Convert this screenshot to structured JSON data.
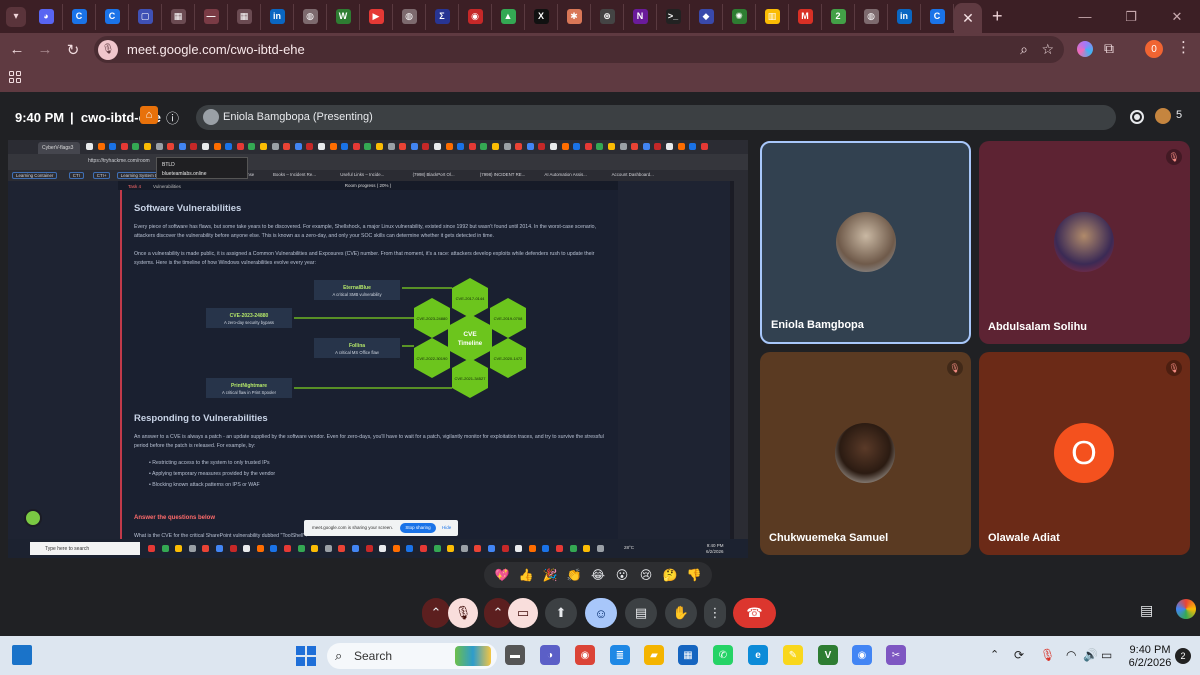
{
  "browser": {
    "tab_menu_icon": "chevron-down-icon",
    "tabs": [
      {
        "icon": "discord-icon",
        "color": "#5865f2",
        "glyph": "◕"
      },
      {
        "icon": "c-app-icon",
        "color": "#1a73e8",
        "glyph": "C"
      },
      {
        "icon": "c-app-icon",
        "color": "#1a73e8",
        "glyph": "C"
      },
      {
        "icon": "app-icon",
        "color": "#3f51b5",
        "glyph": "▢"
      },
      {
        "icon": "grid-icon",
        "color": "#6b4b52",
        "glyph": "▦"
      },
      {
        "icon": "dash-icon",
        "color": "#7a3b45",
        "glyph": "—"
      },
      {
        "icon": "grid-icon",
        "color": "#6b4b52",
        "glyph": "▦"
      },
      {
        "icon": "linkedin-icon",
        "color": "#0a66c2",
        "glyph": "in"
      },
      {
        "icon": "globe-icon",
        "color": "#7d6a6e",
        "glyph": "◍"
      },
      {
        "icon": "w-app-icon",
        "color": "#2e7d32",
        "glyph": "W"
      },
      {
        "icon": "youtube-icon",
        "color": "#e53935",
        "glyph": "▶"
      },
      {
        "icon": "globe-icon",
        "color": "#7d6a6e",
        "glyph": "◍"
      },
      {
        "icon": "app-icon",
        "color": "#283593",
        "glyph": "Σ"
      },
      {
        "icon": "app-icon",
        "color": "#c62828",
        "glyph": "◉"
      },
      {
        "icon": "drive-icon",
        "color": "#34a853",
        "glyph": "▲"
      },
      {
        "icon": "x-icon",
        "color": "#111111",
        "glyph": "X"
      },
      {
        "icon": "claude-icon",
        "color": "#d97757",
        "glyph": "✱"
      },
      {
        "icon": "chatgpt-icon",
        "color": "#444444",
        "glyph": "⊛"
      },
      {
        "icon": "n-app-icon",
        "color": "#6a1b9a",
        "glyph": "N"
      },
      {
        "icon": "terminal-icon",
        "color": "#222222",
        "glyph": ">_"
      },
      {
        "icon": "app-icon",
        "color": "#3949ab",
        "glyph": "◆"
      },
      {
        "icon": "app-icon",
        "color": "#2e7d32",
        "glyph": "✺"
      },
      {
        "icon": "app-icon",
        "color": "#fbbc04",
        "glyph": "▥"
      },
      {
        "icon": "gmail-icon",
        "color": "#d93025",
        "glyph": "M"
      },
      {
        "icon": "app-icon",
        "color": "#43a047",
        "glyph": "2"
      },
      {
        "icon": "globe-icon",
        "color": "#7d6a6e",
        "glyph": "◍"
      },
      {
        "icon": "linkedin-icon",
        "color": "#0a66c2",
        "glyph": "in"
      },
      {
        "icon": "c-app-icon",
        "color": "#1a73e8",
        "glyph": "C"
      }
    ],
    "active_tab_close": "✕",
    "new_tab": "+",
    "window_controls": [
      "—",
      "❐",
      "✕"
    ],
    "back": "←",
    "forward": "→",
    "reload": "↻",
    "url": "meet.google.com/cwo-ibtd-ehe",
    "profile_initial": "0",
    "kebab": "⋮"
  },
  "meet": {
    "time": "9:40 PM",
    "separator": "|",
    "code": "cwo-ibtd-ehe",
    "presenting_label": "Eniola Bamgbopa (Presenting)",
    "participant_count": "5",
    "participants": [
      {
        "name": "Eniola Bamgbopa",
        "muted": false
      },
      {
        "name": "Abdulsalam Solihu",
        "muted": true
      },
      {
        "name": "Chukwuemeka Samuel",
        "muted": true
      },
      {
        "name": "Olawale Adiat",
        "muted": true,
        "initial": "O"
      }
    ],
    "reactions": [
      "💖",
      "👍",
      "🎉",
      "👏",
      "😂",
      "😮",
      "😢",
      "🤔",
      "👎"
    ],
    "controls": {
      "mic_off": "mic-off-icon",
      "cam_off": "camera-off-icon",
      "present": "present-screen-icon",
      "emoji": "emoji-icon",
      "captions": "captions-icon",
      "raise_hand": "raise-hand-icon",
      "more": "more-options-icon",
      "end_call": "end-call-icon"
    }
  },
  "shared_screen": {
    "tab_title": "CyberV-flags3",
    "url": "https://tryhackme.com/room",
    "tooltip_title": "BTLD",
    "tooltip_sub": "blueteamlabs.online",
    "bookmarks": [
      "Learning Container",
      "CTI",
      "CTI+",
      "Learning System Design",
      "CCNA",
      "SA Incident Response",
      "Books – Incident Re...",
      "Useful Links – Incide...",
      "(7998) BlackPort Ol...",
      "(7998) INCIDENT RE...",
      "AI Automation Assis...",
      "Account Dashboard..."
    ],
    "task_label": "Task 4",
    "task_title": "Vulnerabilities",
    "room_progress": "Room progress ( 20% )",
    "heading1": "Software Vulnerabilities",
    "para1": "Every piece of software has flaws, but some take years to be discovered. For example, Shellshock, a major Linux vulnerability, existed since 1992 but wasn't found until 2014. In the worst-case scenario, attackers discover the vulnerability before anyone else. This is known as a zero-day, and only your SOC skills can determine whether it gets detected in time.",
    "para2": "Once a vulnerability is made public, it is assigned a Common Vulnerabilities and Exposures (CVE) number. From that moment, it's a race: attackers develop exploits while defenders rush to update their systems. Here is the timeline of how Windows vulnerabilities evolve every year:",
    "diagram": {
      "center_title": "CVE",
      "center_sub": "Timeline",
      "cves": [
        "CVE-2017-0144",
        "CVE-2023-24880",
        "CVE-2019-0708",
        "CVE-2022-30190",
        "CVE-2020-1472",
        "CVE-2021-34527"
      ],
      "callouts": [
        {
          "title": "EternalBlue",
          "desc": "A critical SMB vulnerability"
        },
        {
          "title": "CVE-2023-24880",
          "desc": "A zero-day security bypass"
        },
        {
          "title": "Follina",
          "desc": "A critical MS Office flaw"
        },
        {
          "title": "PrintNightmare",
          "desc": "A critical flaw in Print Spooler"
        }
      ]
    },
    "heading2": "Responding to Vulnerabilities",
    "para3": "An answer to a CVE is always a patch - an update supplied by the software vendor. Even for zero-days, you'll have to wait for a patch, vigilantly monitor for exploitation traces, and try to survive the stressful period before the patch is released. For example, by:",
    "bullets": [
      "Restricting access to the system to only trusted IPs",
      "Applying temporary measures provided by the vendor",
      "Blocking known attack patterns on IPS or WAF"
    ],
    "answer_heading": "Answer the questions below",
    "question": "What is the CVE for the critical SharePoint vulnerability dubbed \"ToolShell\"?",
    "share_text": "meet.google.com is sharing your screen.",
    "stop_label": "Stop sharing",
    "hide_label": "Hide",
    "taskbar_search": "Type here to search",
    "temp": "28°C",
    "time": "9:40 PM",
    "date": "6/2/2026"
  },
  "taskbar": {
    "search_label": "Search",
    "time": "9:40 PM",
    "date": "6/2/2026",
    "notifications": "2",
    "apps": [
      {
        "icon": "file-explorer-icon",
        "color": "#555555",
        "glyph": "▬"
      },
      {
        "icon": "chat-app-icon",
        "color": "#5b5fc7",
        "glyph": "◑"
      },
      {
        "icon": "chrome-icon",
        "color": "#db4437",
        "glyph": "◉"
      },
      {
        "icon": "notepad-icon",
        "color": "#1e88e5",
        "glyph": "≣"
      },
      {
        "icon": "folder-icon",
        "color": "#f4b400",
        "glyph": "▰"
      },
      {
        "icon": "store-icon",
        "color": "#1565c0",
        "glyph": "▦"
      },
      {
        "icon": "whatsapp-icon",
        "color": "#25d366",
        "glyph": "✆"
      },
      {
        "icon": "edge-icon",
        "color": "#0c8bd8",
        "glyph": "e"
      },
      {
        "icon": "sticky-notes-icon",
        "color": "#f9d71c",
        "glyph": "✎"
      },
      {
        "icon": "vscode-like-icon",
        "color": "#2e7d32",
        "glyph": "V"
      },
      {
        "icon": "chrome-icon",
        "color": "#4285f4",
        "glyph": "◉"
      },
      {
        "icon": "snip-icon",
        "color": "#7e57c2",
        "glyph": "✂"
      }
    ]
  }
}
